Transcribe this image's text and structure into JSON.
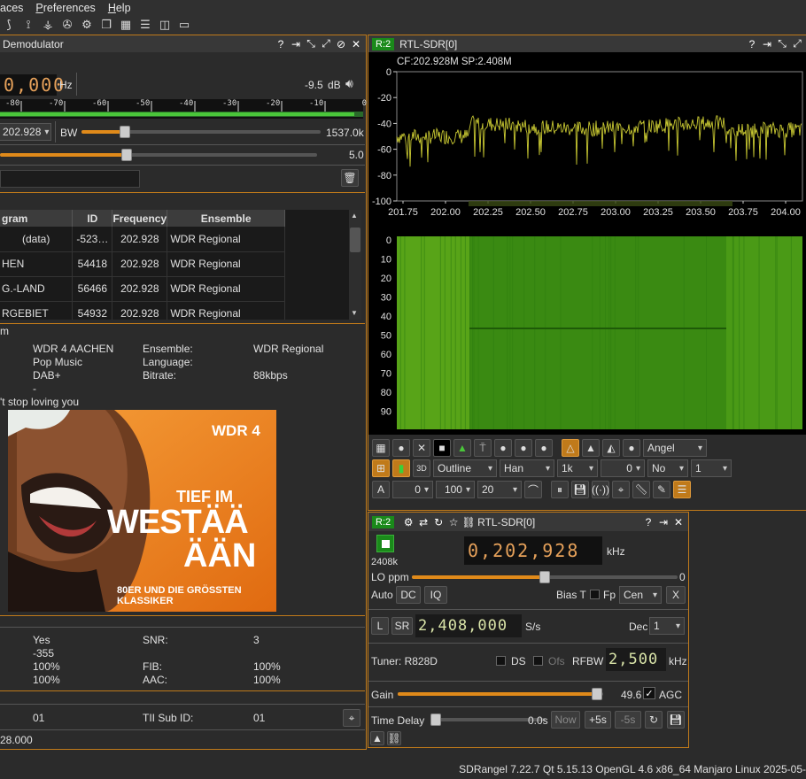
{
  "menu": {
    "items": [
      "aces",
      "Preferences",
      "Help"
    ]
  },
  "demod": {
    "title": "Demodulator",
    "freq_digits": "0,000",
    "freq_unit": "Hz",
    "power": "-9.5",
    "power_unit": "dB",
    "meter_ticks": [
      "-80",
      "-70",
      "-60",
      "-50",
      "-40",
      "-30",
      "-20",
      "-10",
      "0"
    ],
    "channel_combo": "202.928",
    "bw_label": "BW",
    "bw_value": "1537.0k",
    "second_value": "5.0",
    "bw_fraction": 0.18,
    "second_fraction": 0.4,
    "table": {
      "headers": [
        "gram",
        "ID",
        "Frequency",
        "Ensemble"
      ],
      "rows": [
        [
          "(data)",
          "-523…",
          "202.928",
          "WDR Regional"
        ],
        [
          "HEN",
          "54418",
          "202.928",
          "WDR Regional"
        ],
        [
          "G.-LAND",
          "56466",
          "202.928",
          "WDR Regional"
        ],
        [
          "RGEBIET",
          "54932",
          "202.928",
          "WDR Regional"
        ]
      ]
    },
    "program_section": "m",
    "program_name": "WDR 4 AACHEN",
    "genre": "Pop Music",
    "codec": "DAB+",
    "dash": "-",
    "ensemble_label": "Ensemble:",
    "ensemble_value": "WDR Regional",
    "language_label": "Language:",
    "bitrate_label": "Bitrate:",
    "bitrate_value": "88kbps",
    "dls": "'t stop loving you",
    "image": {
      "logo": "WDR 4",
      "line1": "TIEF IM",
      "line2": "WESTÄÄ",
      "line3": "ÄÄN",
      "line4": "80ER UND DIE GRÖSSTEN KLASSIKER"
    },
    "status": {
      "sync": "Yes",
      "offset": "-355",
      "p1": "100%",
      "p2": "100%",
      "snr_label": "SNR:",
      "snr_value": "3",
      "fib_label": "FIB:",
      "fib_value": "100%",
      "aac_label": "AAC:",
      "aac_value": "100%"
    },
    "tii_value": "01",
    "tii_sub_label": "TII Sub ID:",
    "tii_sub_value": "01",
    "bottom_freq": "28.000"
  },
  "spectrum": {
    "tag": "R:2",
    "title": "RTL-SDR[0]",
    "info": "CF:202.928M SP:2.408M",
    "y_ticks": [
      "0",
      "-20",
      "-40",
      "-60",
      "-80",
      "-100"
    ],
    "x_ticks": [
      "201.75",
      "202.00",
      "202.25",
      "202.50",
      "202.75",
      "203.00",
      "203.25",
      "203.50",
      "203.75",
      "204.00"
    ],
    "wf_ticks": [
      "0",
      "10",
      "20",
      "30",
      "40",
      "50",
      "60",
      "70",
      "80",
      "90"
    ],
    "controls": {
      "palette": "Angel",
      "outline": "Outline",
      "window": "Han",
      "fft": "1k",
      "overlap": "0",
      "no": "No",
      "one": "1",
      "a_btn": "A",
      "ref": "0",
      "range": "100",
      "rate": "20"
    }
  },
  "device": {
    "tag": "R:2",
    "title": "RTL-SDR[0]",
    "sample_rate_short": "2408k",
    "freq_digits": "0,202,928",
    "freq_unit": "kHz",
    "lo_label": "LO ppm",
    "lo_value": "0",
    "lo_fraction": 0.5,
    "auto_label": "Auto",
    "dc": "DC",
    "iq": "IQ",
    "bias_label": "Bias T",
    "fp_label": "Fp",
    "fp_combo": "Cen",
    "x_btn": "X",
    "l_btn": "L",
    "sr_btn": "SR",
    "sr_digits": "2,408,000",
    "sr_unit": "S/s",
    "dec_label": "Dec",
    "dec_value": "1",
    "tuner": "Tuner: R828D",
    "ds_label": "DS",
    "ofs_label": "Ofs",
    "rfbw_label": "RFBW",
    "rfbw_digits": "2,500",
    "rfbw_unit": "kHz",
    "gain_label": "Gain",
    "gain_value": "49.6",
    "gain_fraction": 0.97,
    "agc_label": "AGC",
    "td_label": "Time Delay",
    "td_value": "0.0s",
    "now_btn": "Now",
    "plus5": "+5s",
    "minus5": "-5s"
  },
  "statusbar": "SDRangel 7.22.7 Qt 5.15.13 OpenGL 4.6 x86_64 Manjaro Linux  2025-05-",
  "colors": {
    "accent": "#c07a1a",
    "slider": "#e08a1a",
    "spectrum": "#c8c832",
    "waterfall": "#3f8f14"
  }
}
